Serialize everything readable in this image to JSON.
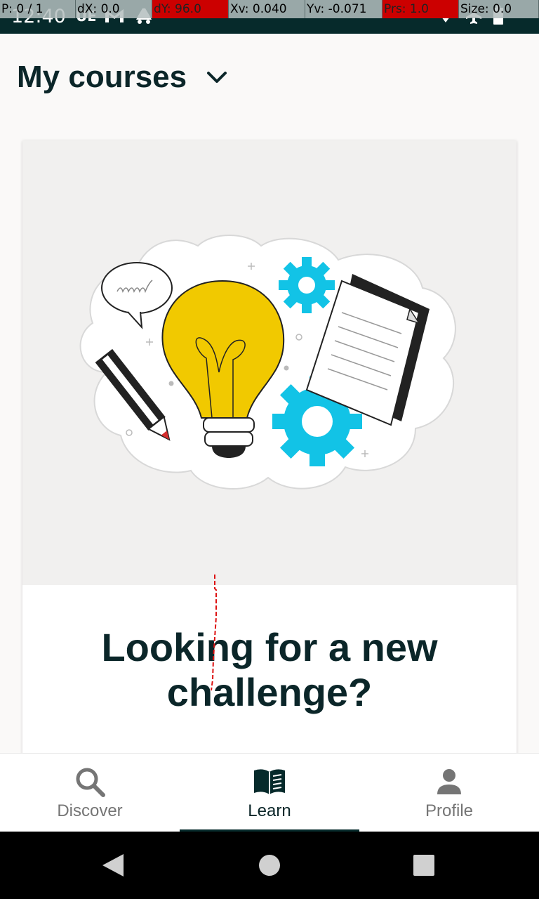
{
  "status_bar": {
    "time": "12:40",
    "left_icons": [
      "ue-icon",
      "gmail-icon",
      "drive-icon"
    ],
    "right_icons": [
      "wifi-icon",
      "airplane-icon",
      "battery-icon"
    ]
  },
  "debug_overlay": {
    "p": "P: 0 / 1",
    "dx": "dX: 0.0",
    "dy": "dY: 96.0",
    "xv": "Xv: 0.040",
    "yv": "Yv: -0.071",
    "prs": "Prs: 1.0",
    "size": "Size: 0.0"
  },
  "header": {
    "title": "My courses"
  },
  "card": {
    "heading": "Looking for a new challenge?"
  },
  "bottom_nav": {
    "items": [
      {
        "label": "Discover",
        "icon": "search-icon",
        "active": false
      },
      {
        "label": "Learn",
        "icon": "book-icon",
        "active": true
      },
      {
        "label": "Profile",
        "icon": "person-icon",
        "active": false
      }
    ]
  },
  "colors": {
    "brand_dark": "#062a2b",
    "accent_yellow": "#f1c900",
    "accent_cyan": "#12c3e6",
    "inactive_gray": "#757575"
  }
}
